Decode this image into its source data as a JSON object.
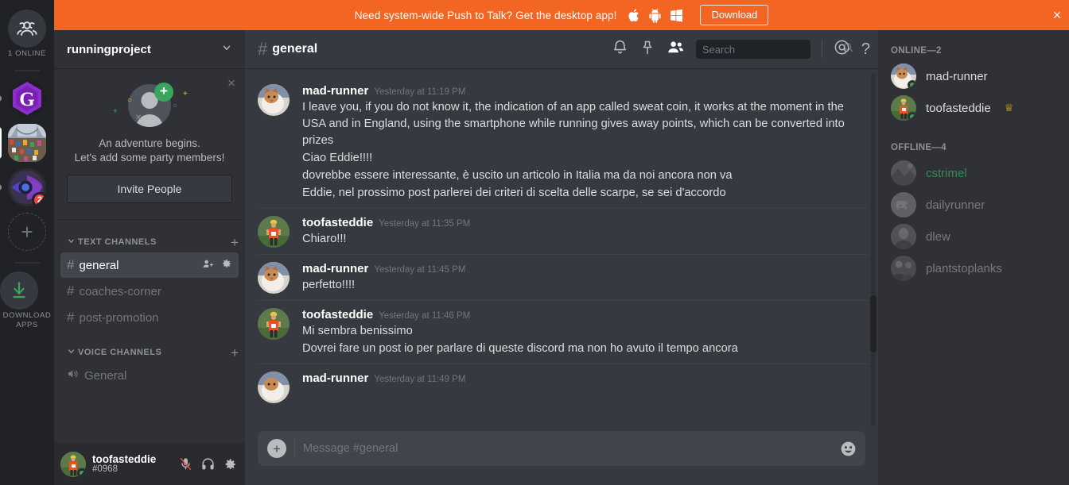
{
  "banner": {
    "text": "Need system-wide Push to Talk? Get the desktop app!",
    "download_label": "Download",
    "close_label": "×",
    "bg_color": "#f26522",
    "platform_icons": [
      "apple-icon",
      "android-icon",
      "windows-icon"
    ]
  },
  "rail": {
    "home_label": "1 ONLINE",
    "home_icon": "friends-icon",
    "guilds": [
      {
        "name": "guild-gravel",
        "icon": "letter-g-hexagon-logo",
        "badge": null,
        "active": false
      },
      {
        "name": "guild-running-project",
        "icon": "marathon-bridge-photo",
        "badge": null,
        "active": true
      },
      {
        "name": "guild-eye",
        "icon": "eye-logo",
        "badge": "2",
        "active": false
      }
    ],
    "add_label": "+",
    "download_label": "DOWNLOAD APPS",
    "download_icon": "download-arrow-icon"
  },
  "sidebar": {
    "guild_name": "runningproject",
    "invite": {
      "line1": "An adventure begins.",
      "line2": "Let's add some party members!",
      "button": "Invite People",
      "close": "×"
    },
    "categories": [
      {
        "name": "TEXT CHANNELS",
        "type": "text",
        "channels": [
          {
            "name": "general",
            "active": true
          },
          {
            "name": "coaches-corner",
            "active": false
          },
          {
            "name": "post-promotion",
            "active": false
          }
        ]
      },
      {
        "name": "VOICE CHANNELS",
        "type": "voice",
        "channels": [
          {
            "name": "General",
            "active": false
          }
        ]
      }
    ]
  },
  "user": {
    "name": "toofasteddie",
    "tag": "#0968",
    "status": "online",
    "icons": [
      "microphone-muted-icon",
      "headphones-icon",
      "user-settings-gear-icon"
    ]
  },
  "chat_header": {
    "hash": "#",
    "channel": "general",
    "icons": [
      "bell-icon",
      "pin-icon",
      "members-icon",
      "mention-icon",
      "help-icon"
    ]
  },
  "search": {
    "placeholder": "Search",
    "icon": "search-icon"
  },
  "messages": [
    {
      "author": "mad-runner",
      "avatar": "cat-photo",
      "time": "Yesterday at 11:19 PM",
      "lines": [
        "I leave you, if you do not know it, the indication of an app called sweat coin, it works at the moment in the USA and in England, using the smartphone while running gives away points, which can be converted into prizes",
        "Ciao Eddie!!!!",
        "dovrebbe essere interessante, è uscito un articolo in Italia ma da noi ancora non va",
        "Eddie, nel prossimo post parlerei dei criteri di scelta delle scarpe, se sei d'accordo"
      ]
    },
    {
      "author": "toofasteddie",
      "avatar": "runner-photo",
      "time": "Yesterday at 11:35 PM",
      "lines": [
        "Chiaro!!!"
      ]
    },
    {
      "author": "mad-runner",
      "avatar": "cat-photo",
      "time": "Yesterday at 11:45 PM",
      "lines": [
        "perfetto!!!!"
      ]
    },
    {
      "author": "toofasteddie",
      "avatar": "runner-photo",
      "time": "Yesterday at 11:46 PM",
      "lines": [
        "Mi sembra benissimo",
        "Dovrei fare un post io per parlare di queste discord ma non ho avuto il tempo ancora"
      ]
    },
    {
      "author": "mad-runner",
      "avatar": "cat-photo",
      "time": "Yesterday at 11:49 PM",
      "lines": []
    }
  ],
  "composer": {
    "placeholder": "Message #general",
    "plus_label": "+",
    "emoji_icon": "emoji-icon"
  },
  "members": {
    "online_header": "ONLINE—2",
    "offline_header": "OFFLINE—4",
    "online": [
      {
        "name": "mad-runner",
        "avatar": "cat-photo",
        "owner": false
      },
      {
        "name": "toofasteddie",
        "avatar": "runner-photo",
        "owner": true
      }
    ],
    "offline": [
      {
        "name": "cstrimel",
        "avatar": "landscape-photo",
        "color": "#3ba55d"
      },
      {
        "name": "dailyrunner",
        "avatar": "discord-default-icon",
        "color": null
      },
      {
        "name": "dlew",
        "avatar": "person-photo",
        "color": null
      },
      {
        "name": "plantstoplanks",
        "avatar": "group-photo",
        "color": null
      }
    ]
  },
  "colors": {
    "accent_orange": "#f26522",
    "sidebar_bg": "#2f3136",
    "chat_bg": "#36393f",
    "rail_bg": "#202225",
    "online_green": "#3ba55d",
    "badge_red": "#f04747"
  }
}
